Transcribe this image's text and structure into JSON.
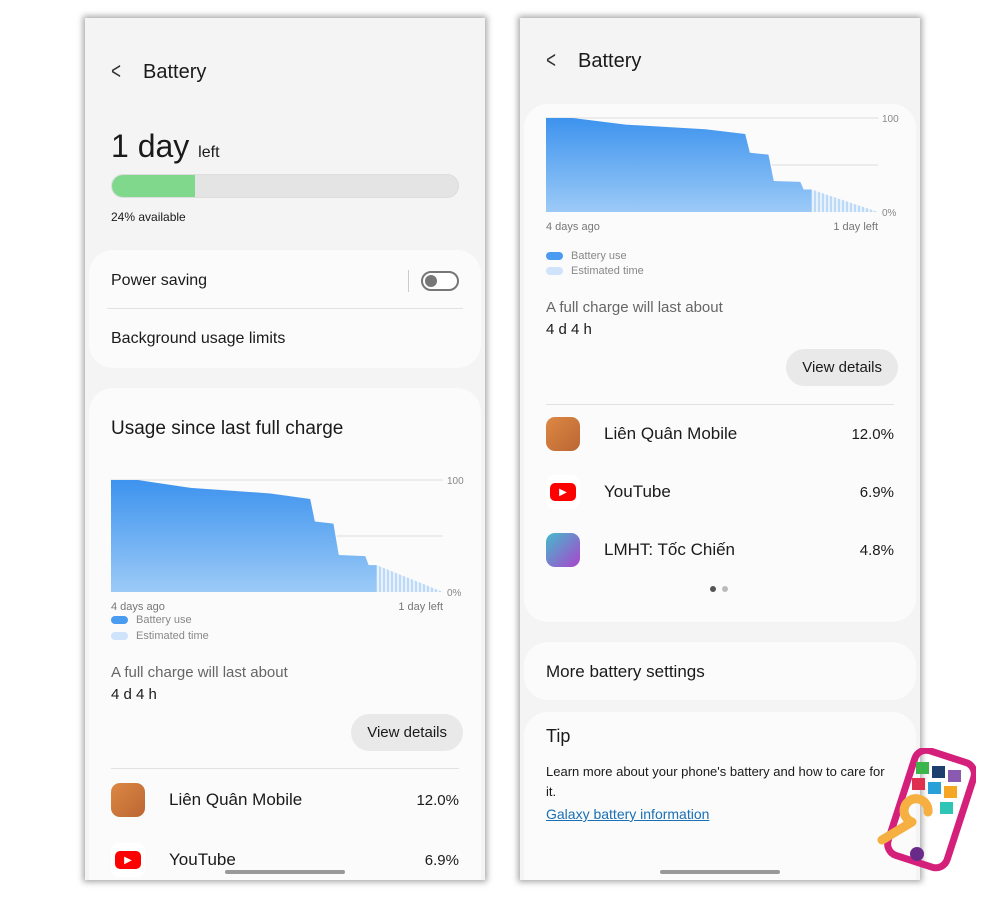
{
  "header": {
    "title": "Battery"
  },
  "summary": {
    "time_left": "1 day",
    "left_label": "left",
    "available": "24% available",
    "level_percent": 24
  },
  "settings": {
    "power_saving": "Power saving",
    "power_saving_on": false,
    "background_limits": "Background usage limits"
  },
  "usage": {
    "title": "Usage since last full charge",
    "full_charge_label": "A full charge will last about",
    "full_charge_value": "4 d 4 h",
    "view_details": "View details"
  },
  "chart_data": {
    "type": "area",
    "xlabel_start": "4 days ago",
    "xlabel_end": "1 day left",
    "y_ticks": [
      "100",
      "0%"
    ],
    "ylim": [
      0,
      100
    ],
    "legend": [
      "Battery use",
      "Estimated time"
    ],
    "battery_use": [
      [
        -4,
        100
      ],
      [
        -3.6,
        100
      ],
      [
        -2.8,
        93
      ],
      [
        -1.6,
        88
      ],
      [
        -1.0,
        83
      ],
      [
        -0.93,
        63
      ],
      [
        -0.65,
        61
      ],
      [
        -0.57,
        33
      ],
      [
        -0.17,
        32
      ],
      [
        -0.12,
        24
      ],
      [
        0,
        24
      ]
    ],
    "estimated": [
      [
        0,
        24
      ],
      [
        1,
        0
      ]
    ],
    "colors": {
      "use": "#4a9cf0",
      "estimated": "#cfe3fa"
    }
  },
  "apps": [
    {
      "name": "Liên Quân Mobile",
      "pct": "12.0%",
      "icon": "lien-quan-icon"
    },
    {
      "name": "YouTube",
      "pct": "6.9%",
      "icon": "youtube-icon"
    },
    {
      "name": "LMHT: Tốc Chiến",
      "pct": "4.8%",
      "icon": "lmht-icon"
    }
  ],
  "more": {
    "label": "More battery settings"
  },
  "tip": {
    "title": "Tip",
    "text": "Learn more about your phone's battery and how to care for it.",
    "link": "Galaxy battery information"
  },
  "colors": {
    "accent": "#1a6fb5",
    "battery_fill": "#7fd88b"
  }
}
